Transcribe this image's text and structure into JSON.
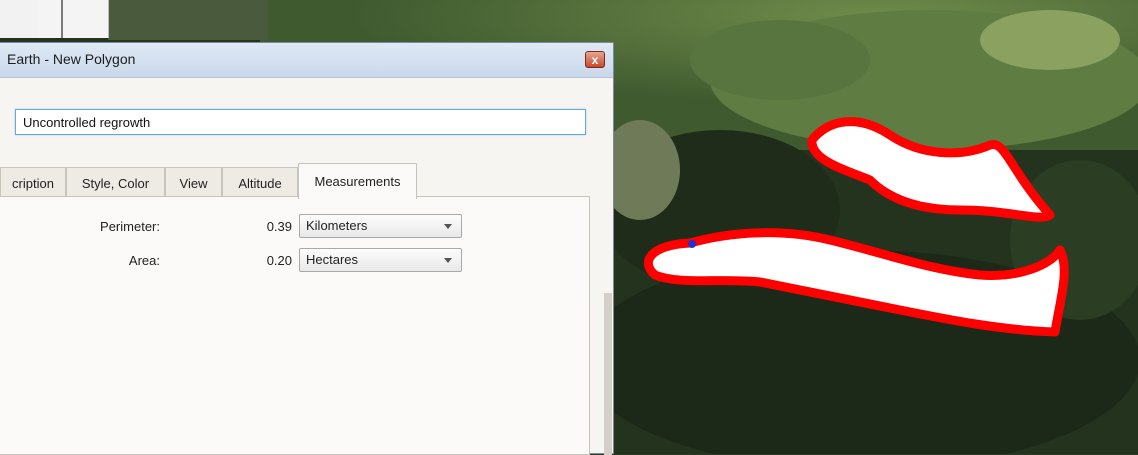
{
  "dialog": {
    "title": "Earth - New Polygon",
    "close_glyph": "x",
    "name_value": "Uncontrolled regrowth"
  },
  "tabs": [
    {
      "label": "cription"
    },
    {
      "label": "Style, Color"
    },
    {
      "label": "View"
    },
    {
      "label": "Altitude"
    },
    {
      "label": "Measurements"
    }
  ],
  "measurements": {
    "perimeter": {
      "label": "Perimeter:",
      "value": "0.39",
      "unit": "Kilometers"
    },
    "area": {
      "label": "Area:",
      "value": "0.20",
      "unit": "Hectares"
    }
  },
  "map": {
    "polygon_color": "#ff0000",
    "fill_color": "#ffffff"
  }
}
